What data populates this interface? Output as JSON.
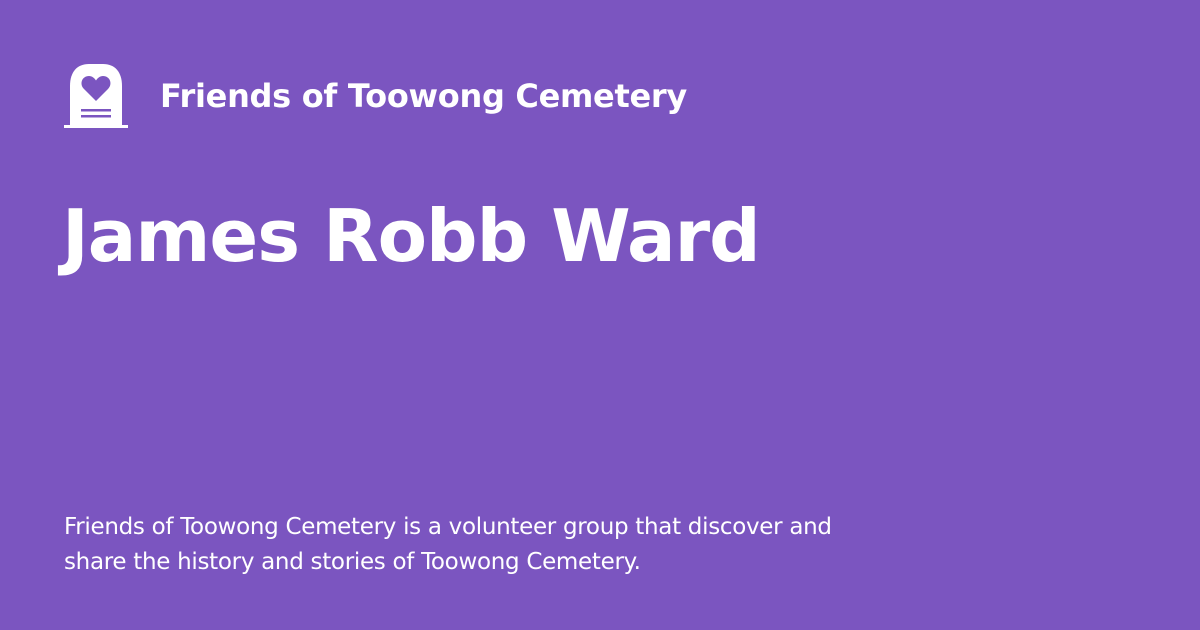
{
  "site": {
    "name": "Friends of Toowong Cemetery",
    "logo_icon": "headstone-heart-icon"
  },
  "page": {
    "title": "James Robb Ward",
    "description": "Friends of Toowong Cemetery is a volunteer group that discover and share the history and stories of Toowong Cemetery."
  },
  "colors": {
    "background": "#7b55c0",
    "text": "#ffffff"
  }
}
